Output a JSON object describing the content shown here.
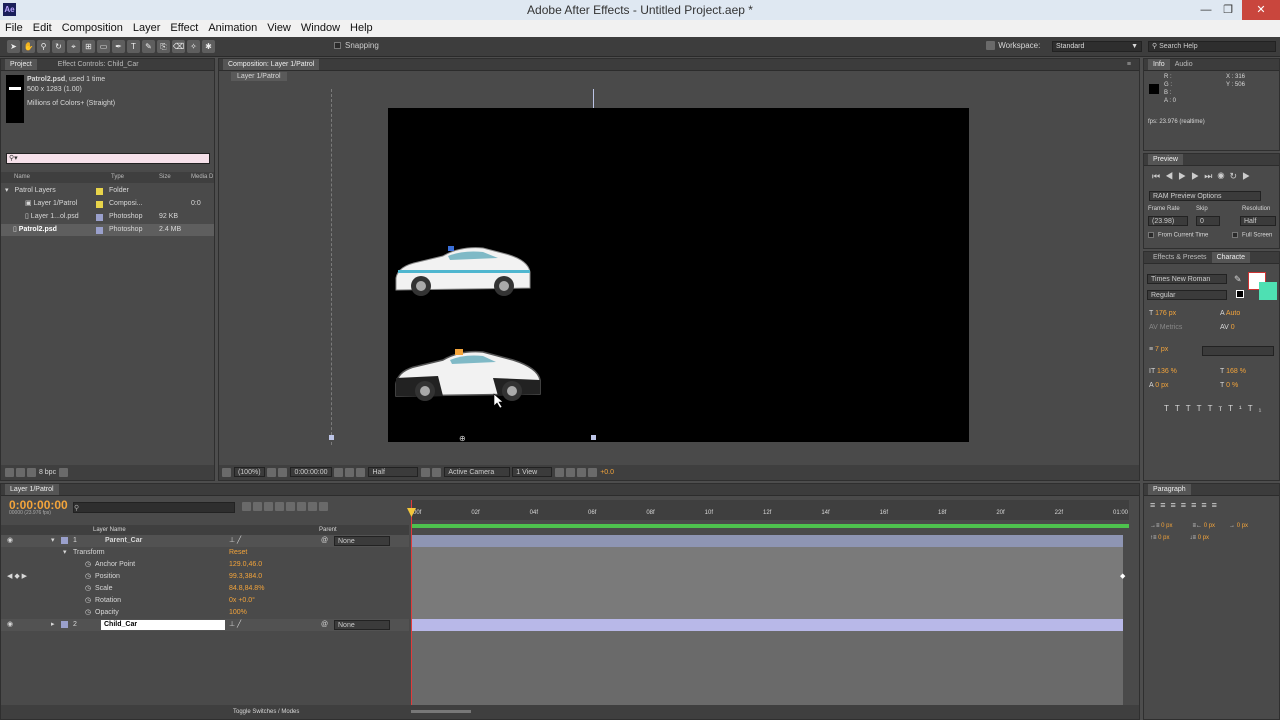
{
  "window": {
    "title": "Adobe After Effects - Untitled Project.aep *",
    "logo": "Ae",
    "min": "—",
    "max": "❐",
    "close": "✕"
  },
  "menu": [
    "File",
    "Edit",
    "Composition",
    "Layer",
    "Effect",
    "Animation",
    "View",
    "Window",
    "Help"
  ],
  "toolbar": {
    "snapping_label": "Snapping",
    "workspace_label": "Workspace:",
    "workspace_value": "Standard",
    "search_placeholder": "Search Help"
  },
  "project": {
    "tabs": [
      "Project",
      "Effect Controls: Child_Car"
    ],
    "selected_name": "Patrol2.psd",
    "selected_usage": ", used 1 time",
    "selected_dims": "500 x 1283 (1.00)",
    "selected_colors": "Millions of Colors+ (Straight)",
    "columns": [
      "Name",
      "Type",
      "Size",
      "Media D"
    ],
    "items": [
      {
        "name": "Patrol Layers",
        "type": "Folder",
        "size": "",
        "dur": "",
        "color": "#e8d44a"
      },
      {
        "name": "Layer 1/Patrol",
        "type": "Composi...",
        "size": "",
        "dur": "0:0",
        "color": "#e8d44a"
      },
      {
        "name": "Layer 1...ol.psd",
        "type": "Photoshop",
        "size": "92 KB",
        "dur": "",
        "color": "#9aa0cc"
      },
      {
        "name": "Patrol2.psd",
        "type": "Photoshop",
        "size": "2.4 MB",
        "dur": "",
        "color": "#9aa0cc"
      }
    ],
    "bpc": "8 bpc"
  },
  "composition": {
    "tab": "Composition: Layer 1/Patrol",
    "subtab": "Layer 1/Patrol",
    "zoom": "(100%)",
    "timecode": "0:00:00:00",
    "resolution": "Half",
    "camera": "Active Camera",
    "view": "1 View",
    "exposure": "+0.0"
  },
  "info": {
    "tabs": [
      "Info",
      "Audio"
    ],
    "r": "R :",
    "g": "G :",
    "b": "B :",
    "a": "A : 0",
    "x": "X : 316",
    "y": "Y : 506",
    "fps": "fps: 23.976 (realtime)"
  },
  "preview": {
    "tab": "Preview",
    "ram": "RAM Preview Options",
    "frame_rate_label": "Frame Rate",
    "skip_label": "Skip",
    "resolution_label": "Resolution",
    "frame_rate": "(23.98)",
    "skip": "0",
    "resolution": "Half",
    "from_current": "From Current Time",
    "full_screen": "Full Screen"
  },
  "character": {
    "tabs": [
      "Effects & Presets",
      "Characte"
    ],
    "font": "Times New Roman",
    "style": "Regular",
    "size": "176 px",
    "leading": "Auto",
    "kerning": "Metrics",
    "tracking": "0",
    "stroke": "7 px",
    "vscale": "136 %",
    "hscale": "168 %",
    "baseline": "0 px",
    "tsume": "0 %"
  },
  "paragraph": {
    "tab": "Paragraph",
    "indent1": "0 px",
    "indent2": "0 px",
    "indent3": "0 px",
    "space1": "0 px",
    "space2": "0 px"
  },
  "timeline": {
    "tab": "Layer 1/Patrol",
    "timecode": "0:00:00:00",
    "fps": "00000 (23.976 fps)",
    "col_layer_name": "Layer Name",
    "col_parent": "Parent",
    "ticks": [
      "00f",
      "02f",
      "04f",
      "06f",
      "08f",
      "10f",
      "12f",
      "14f",
      "16f",
      "18f",
      "20f",
      "22f",
      "01:00"
    ],
    "layers": [
      {
        "num": "1",
        "name": "Parent_Car",
        "parent": "None"
      },
      {
        "num": "2",
        "name": "Child_Car",
        "parent": "None"
      }
    ],
    "transform_label": "Transform",
    "reset": "Reset",
    "props": [
      {
        "name": "Anchor Point",
        "value": "129.0,46.0"
      },
      {
        "name": "Position",
        "value": "99.3,384.0"
      },
      {
        "name": "Scale",
        "value": "84.8,84.8%"
      },
      {
        "name": "Rotation",
        "value": "0x +0.0°"
      },
      {
        "name": "Opacity",
        "value": "100%"
      }
    ],
    "toggle": "Toggle Switches / Modes"
  }
}
